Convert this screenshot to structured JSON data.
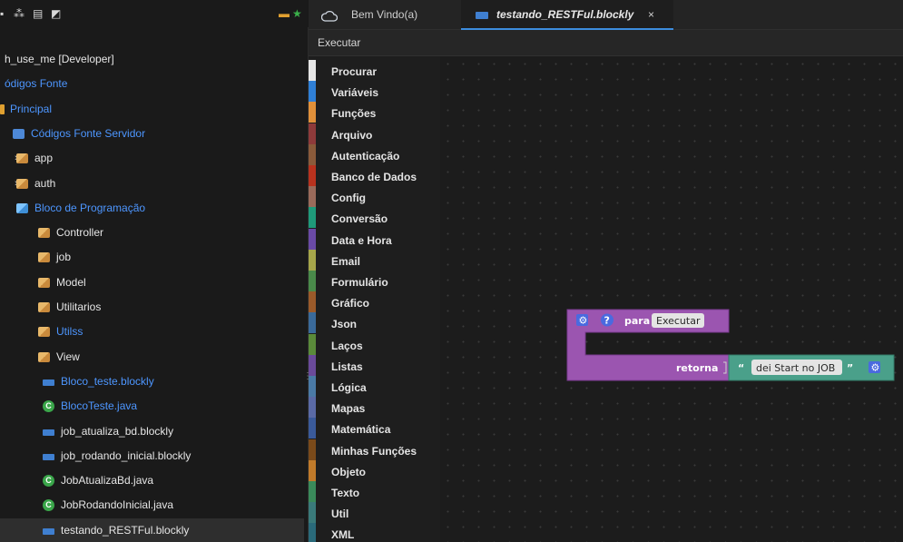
{
  "sidebar": {
    "items": [
      {
        "label": "h_use_me [Developer]",
        "kind": "none",
        "link": false,
        "chevron": "",
        "indent": 0
      },
      {
        "label": "ódigos Fonte",
        "kind": "none",
        "link": true,
        "chevron": "",
        "indent": 0
      },
      {
        "label": "Principal",
        "kind": "folder-icon",
        "link": true,
        "chevron": "",
        "indent": 0
      },
      {
        "label": "Códigos Fonte Servidor",
        "kind": "server-icon",
        "link": true,
        "chevron": "",
        "indent": 1
      },
      {
        "label": "app",
        "kind": "package-icon",
        "link": false,
        "chevron": "›",
        "indent": 1
      },
      {
        "label": "auth",
        "kind": "package-icon",
        "link": false,
        "chevron": "›",
        "indent": 1
      },
      {
        "label": "Bloco de Programação",
        "kind": "package-blue-icon",
        "link": true,
        "chevron": "⌄",
        "indent": 1
      },
      {
        "label": "Controller",
        "kind": "package-icon",
        "link": false,
        "chevron": "›",
        "indent": 2
      },
      {
        "label": "job",
        "kind": "package-icon",
        "link": false,
        "chevron": "›",
        "indent": 2
      },
      {
        "label": "Model",
        "kind": "package-icon",
        "link": false,
        "chevron": "›",
        "indent": 2
      },
      {
        "label": "Utilitarios",
        "kind": "package-icon",
        "link": false,
        "chevron": "›",
        "indent": 2
      },
      {
        "label": "Utilss",
        "kind": "package-icon",
        "link": true,
        "chevron": "›",
        "indent": 2
      },
      {
        "label": "View",
        "kind": "package-icon",
        "link": false,
        "chevron": "›",
        "indent": 2
      },
      {
        "label": "Bloco_teste.blockly",
        "kind": "blockly-file-icon",
        "link": true,
        "chevron": "",
        "indent": 3
      },
      {
        "label": "BlocoTeste.java",
        "kind": "java-class-icon",
        "link": true,
        "chevron": "",
        "indent": 3
      },
      {
        "label": "job_atualiza_bd.blockly",
        "kind": "blockly-file-icon",
        "link": false,
        "chevron": "",
        "indent": 3
      },
      {
        "label": "job_rodando_inicial.blockly",
        "kind": "blockly-file-icon",
        "link": false,
        "chevron": "",
        "indent": 3
      },
      {
        "label": "JobAtualizaBd.java",
        "kind": "java-class-icon",
        "link": false,
        "chevron": "",
        "indent": 3
      },
      {
        "label": "JobRodandoInicial.java",
        "kind": "java-class-icon",
        "link": false,
        "chevron": "",
        "indent": 3
      },
      {
        "label": "testando_RESTFul.blockly",
        "kind": "blockly-file-icon",
        "link": false,
        "chevron": "",
        "indent": 3,
        "selected": true
      }
    ],
    "toolbar_icons": [
      "hierarchy-icon",
      "database-icon",
      "folder-open-icon",
      "pin-icon",
      "star-icon"
    ]
  },
  "tabs": [
    {
      "label": "Bem Vindo(a)",
      "icon": "cloud-icon",
      "active": false
    },
    {
      "label": "testando_RESTFul.blockly",
      "icon": "blockly-file-icon",
      "active": true,
      "close": "×"
    }
  ],
  "editor_toolbar": {
    "run_label": "Executar"
  },
  "toolbox": {
    "categories": [
      {
        "label": "Procurar",
        "color": "#e6e6e6"
      },
      {
        "label": "Variáveis",
        "color": "#2f7fd6"
      },
      {
        "label": "Funções",
        "color": "#e0903a"
      },
      {
        "label": "Arquivo",
        "color": "#8e3a3a"
      },
      {
        "label": "Autenticação",
        "color": "#8a5a3a"
      },
      {
        "label": "Banco de Dados",
        "color": "#b8321e"
      },
      {
        "label": "Config",
        "color": "#9a6a5a"
      },
      {
        "label": "Conversão",
        "color": "#1f9a7a"
      },
      {
        "label": "Data e Hora",
        "color": "#6a4aa6"
      },
      {
        "label": "Email",
        "color": "#a6a64a"
      },
      {
        "label": "Formulário",
        "color": "#4a8a4a"
      },
      {
        "label": "Gráfico",
        "color": "#9a5a2a"
      },
      {
        "label": "Json",
        "color": "#3a6a9a"
      },
      {
        "label": "Laços",
        "color": "#5a8a3a"
      },
      {
        "label": "Listas",
        "color": "#6a4a9a"
      },
      {
        "label": "Lógica",
        "color": "#4a7aa6"
      },
      {
        "label": "Mapas",
        "color": "#5a6aa6"
      },
      {
        "label": "Matemática",
        "color": "#3a5a9a"
      },
      {
        "label": "Minhas Funções",
        "color": "#7a4a1a"
      },
      {
        "label": "Objeto",
        "color": "#c07a2a"
      },
      {
        "label": "Texto",
        "color": "#3a8a5a"
      },
      {
        "label": "Util",
        "color": "#3a7a7a"
      },
      {
        "label": "XML",
        "color": "#2a6a7a"
      }
    ]
  },
  "workspace": {
    "function_block": {
      "keyword": "para",
      "name": "Executar",
      "return_label": "retorna",
      "string_value": "dei Start no JOB",
      "open_quote": "“",
      "close_quote": "”",
      "block_color": "#9b55b0",
      "text_block_color": "#4aa08a",
      "help_glyph": "?"
    }
  }
}
